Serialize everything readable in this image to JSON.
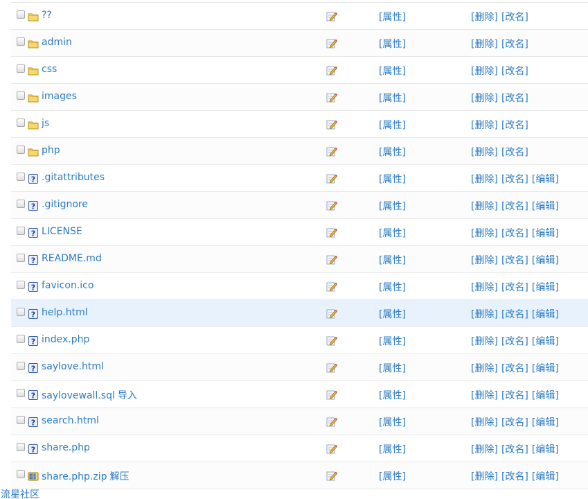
{
  "rows": [
    {
      "name": "??",
      "type": "folder",
      "ops": [
        "[删除]",
        "[改名]"
      ]
    },
    {
      "name": "admin",
      "type": "folder",
      "ops": [
        "[删除]",
        "[改名]"
      ]
    },
    {
      "name": "css",
      "type": "folder",
      "ops": [
        "[删除]",
        "[改名]"
      ]
    },
    {
      "name": "images",
      "type": "folder",
      "ops": [
        "[删除]",
        "[改名]"
      ]
    },
    {
      "name": "js",
      "type": "folder",
      "ops": [
        "[删除]",
        "[改名]"
      ]
    },
    {
      "name": "php",
      "type": "folder",
      "ops": [
        "[删除]",
        "[改名]"
      ]
    },
    {
      "name": ".gitattributes",
      "type": "file",
      "ops": [
        "[删除]",
        "[改名]",
        "[编辑]"
      ]
    },
    {
      "name": ".gitignore",
      "type": "file",
      "ops": [
        "[删除]",
        "[改名]",
        "[编辑]"
      ]
    },
    {
      "name": "LICENSE",
      "type": "file",
      "ops": [
        "[删除]",
        "[改名]",
        "[编辑]"
      ]
    },
    {
      "name": "README.md",
      "type": "file",
      "ops": [
        "[删除]",
        "[改名]",
        "[编辑]"
      ]
    },
    {
      "name": "favicon.ico",
      "type": "file",
      "ops": [
        "[删除]",
        "[改名]",
        "[编辑]"
      ]
    },
    {
      "name": "help.html",
      "type": "file",
      "ops": [
        "[删除]",
        "[改名]",
        "[编辑]"
      ],
      "highlighted": true
    },
    {
      "name": "index.php",
      "type": "file",
      "ops": [
        "[删除]",
        "[改名]",
        "[编辑]"
      ]
    },
    {
      "name": "saylove.html",
      "type": "file",
      "ops": [
        "[删除]",
        "[改名]",
        "[编辑]"
      ]
    },
    {
      "name": "saylovewall.sql",
      "type": "file",
      "extra": "导入",
      "ops": [
        "[删除]",
        "[改名]",
        "[编辑]"
      ]
    },
    {
      "name": "search.html",
      "type": "file",
      "ops": [
        "[删除]",
        "[改名]",
        "[编辑]"
      ]
    },
    {
      "name": "share.php",
      "type": "file",
      "ops": [
        "[删除]",
        "[改名]",
        "[编辑]"
      ]
    },
    {
      "name": "share.php.zip",
      "type": "archive",
      "extra": "解压",
      "ops": [
        "[删除]",
        "[改名]",
        "[编辑]"
      ]
    }
  ],
  "property_label": "[属性]",
  "footer": {
    "link": "流星社区"
  },
  "colors": {
    "link": "#2b7bc5",
    "highlight_row": "#e8f2fd",
    "border": "#e8e8e8",
    "folder": "#f7d96b"
  },
  "icons": {
    "folder": "folder-icon",
    "file": "unknown-file-icon",
    "archive": "archive-icon",
    "edit": "pencil-edit-icon"
  }
}
